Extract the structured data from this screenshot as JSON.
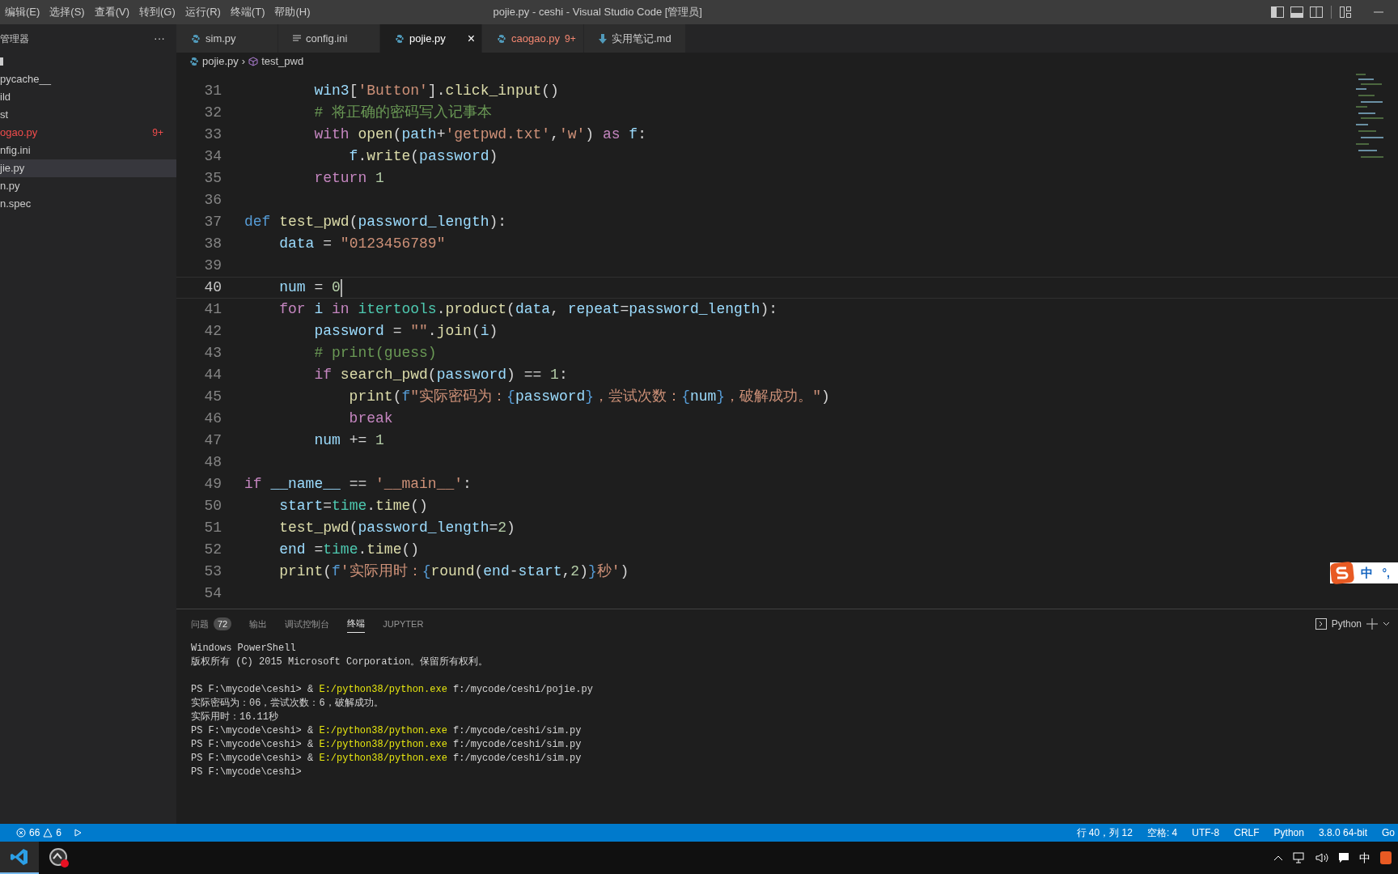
{
  "menu": [
    "编辑(E)",
    "选择(S)",
    "查看(V)",
    "转到(G)",
    "运行(R)",
    "终端(T)",
    "帮助(H)"
  ],
  "window": {
    "title": "pojie.py - ceshi - Visual Studio Code [管理员]"
  },
  "sidebar": {
    "title": "管理器",
    "more": "···",
    "items": [
      {
        "kind": "folder",
        "selected": false
      },
      {
        "label": "pycache__",
        "selected": false,
        "modified": false
      },
      {
        "label": "ild",
        "selected": false,
        "modified": false
      },
      {
        "label": "st",
        "selected": false,
        "modified": false
      },
      {
        "label": "ogao.py",
        "badge": "9+",
        "selected": false,
        "modified": true
      },
      {
        "label": "nfig.ini",
        "selected": false,
        "modified": false
      },
      {
        "label": "jie.py",
        "selected": true,
        "modified": false
      },
      {
        "label": "n.py",
        "selected": false,
        "modified": false
      },
      {
        "label": "n.spec",
        "selected": false,
        "modified": false
      }
    ]
  },
  "tabs": [
    {
      "label": "sim.py",
      "kind": "python",
      "selected": false,
      "modified": false
    },
    {
      "label": "config.ini",
      "kind": "ini",
      "selected": false,
      "modified": false
    },
    {
      "label": "pojie.py",
      "kind": "python",
      "selected": true,
      "modified": false,
      "close": "×"
    },
    {
      "label": "caogao.py",
      "kind": "python",
      "selected": false,
      "modified": true,
      "badge": "9+"
    },
    {
      "label": "实用笔记.md",
      "kind": "markdown",
      "selected": false,
      "modified": false
    }
  ],
  "breadcrumb": {
    "items": [
      "pojie.py",
      "test_pwd"
    ],
    "separator": "›"
  },
  "code": {
    "lines": [
      {
        "number": "31",
        "current": false,
        "segments": [
          {
            "text": "        win3",
            "kind": "variable"
          },
          {
            "text": "[",
            "kind": "plain"
          },
          {
            "text": "'Button'",
            "kind": "string"
          },
          {
            "text": "].",
            "kind": "plain"
          },
          {
            "text": "click_input",
            "kind": "function"
          },
          {
            "text": "()",
            "kind": "plain"
          }
        ]
      },
      {
        "number": "32",
        "current": false,
        "segments": [
          {
            "text": "        # 将正确的密码写入记事本",
            "kind": "comment"
          }
        ]
      },
      {
        "number": "33",
        "current": false,
        "segments": [
          {
            "text": "        with ",
            "kind": "keyword"
          },
          {
            "text": "open",
            "kind": "function"
          },
          {
            "text": "(",
            "kind": "plain"
          },
          {
            "text": "path",
            "kind": "variable"
          },
          {
            "text": "+",
            "kind": "plain"
          },
          {
            "text": "'getpwd.txt'",
            "kind": "string"
          },
          {
            "text": ",",
            "kind": "plain"
          },
          {
            "text": "'w'",
            "kind": "string"
          },
          {
            "text": ") ",
            "kind": "plain"
          },
          {
            "text": "as ",
            "kind": "keyword"
          },
          {
            "text": "f",
            "kind": "variable"
          },
          {
            "text": ":",
            "kind": "plain"
          }
        ]
      },
      {
        "number": "34",
        "current": false,
        "segments": [
          {
            "text": "            f",
            "kind": "variable"
          },
          {
            "text": ".",
            "kind": "plain"
          },
          {
            "text": "write",
            "kind": "function"
          },
          {
            "text": "(",
            "kind": "plain"
          },
          {
            "text": "password",
            "kind": "variable"
          },
          {
            "text": ")",
            "kind": "plain"
          }
        ]
      },
      {
        "number": "35",
        "current": false,
        "segments": [
          {
            "text": "        return ",
            "kind": "keyword"
          },
          {
            "text": "1",
            "kind": "number"
          }
        ]
      },
      {
        "number": "36",
        "current": false
      },
      {
        "number": "37",
        "current": false,
        "segments": [
          {
            "text": "def ",
            "kind": "storage"
          },
          {
            "text": "test_pwd",
            "kind": "function"
          },
          {
            "text": "(",
            "kind": "plain"
          },
          {
            "text": "password_length",
            "kind": "variable"
          },
          {
            "text": "):",
            "kind": "plain"
          }
        ]
      },
      {
        "number": "38",
        "current": false,
        "segments": [
          {
            "text": "    data",
            "kind": "variable"
          },
          {
            "text": " = ",
            "kind": "plain"
          },
          {
            "text": "\"0123456789\"",
            "kind": "string"
          }
        ]
      },
      {
        "number": "39",
        "current": false
      },
      {
        "number": "40",
        "current": true,
        "segments": [
          {
            "text": "    num",
            "kind": "variable"
          },
          {
            "text": " = ",
            "kind": "plain"
          },
          {
            "text": "0",
            "kind": "number"
          }
        ]
      },
      {
        "number": "41",
        "current": false,
        "segments": [
          {
            "text": "    for ",
            "kind": "keyword"
          },
          {
            "text": "i ",
            "kind": "variable"
          },
          {
            "text": "in ",
            "kind": "keyword"
          },
          {
            "text": "itertools",
            "kind": "type"
          },
          {
            "text": ".",
            "kind": "plain"
          },
          {
            "text": "product",
            "kind": "function"
          },
          {
            "text": "(",
            "kind": "plain"
          },
          {
            "text": "data",
            "kind": "variable"
          },
          {
            "text": ", ",
            "kind": "plain"
          },
          {
            "text": "repeat",
            "kind": "variable"
          },
          {
            "text": "=",
            "kind": "plain"
          },
          {
            "text": "password_length",
            "kind": "variable"
          },
          {
            "text": "):",
            "kind": "plain"
          }
        ]
      },
      {
        "number": "42",
        "current": false,
        "segments": [
          {
            "text": "        password",
            "kind": "variable"
          },
          {
            "text": " = ",
            "kind": "plain"
          },
          {
            "text": "\"\"",
            "kind": "string"
          },
          {
            "text": ".",
            "kind": "plain"
          },
          {
            "text": "join",
            "kind": "function"
          },
          {
            "text": "(",
            "kind": "plain"
          },
          {
            "text": "i",
            "kind": "variable"
          },
          {
            "text": ")",
            "kind": "plain"
          }
        ]
      },
      {
        "number": "43",
        "current": false,
        "segments": [
          {
            "text": "        # print(guess)",
            "kind": "comment"
          }
        ]
      },
      {
        "number": "44",
        "current": false,
        "segments": [
          {
            "text": "        if ",
            "kind": "keyword"
          },
          {
            "text": "search_pwd",
            "kind": "function"
          },
          {
            "text": "(",
            "kind": "plain"
          },
          {
            "text": "password",
            "kind": "variable"
          },
          {
            "text": ") == ",
            "kind": "plain"
          },
          {
            "text": "1",
            "kind": "number"
          },
          {
            "text": ":",
            "kind": "plain"
          }
        ]
      },
      {
        "number": "45",
        "current": false,
        "segments": [
          {
            "text": "            print",
            "kind": "function"
          },
          {
            "text": "(",
            "kind": "plain"
          },
          {
            "text": "f",
            "kind": "storage"
          },
          {
            "text": "\"实际密码为：",
            "kind": "string"
          },
          {
            "text": "{",
            "kind": "storage"
          },
          {
            "text": "password",
            "kind": "variable"
          },
          {
            "text": "}",
            "kind": "storage"
          },
          {
            "text": "，尝试次数：",
            "kind": "string"
          },
          {
            "text": "{",
            "kind": "storage"
          },
          {
            "text": "num",
            "kind": "variable"
          },
          {
            "text": "}",
            "kind": "storage"
          },
          {
            "text": "，破解成功。\"",
            "kind": "string"
          },
          {
            "text": ")",
            "kind": "plain"
          }
        ]
      },
      {
        "number": "46",
        "current": false,
        "segments": [
          {
            "text": "            break",
            "kind": "keyword"
          }
        ]
      },
      {
        "number": "47",
        "current": false,
        "segments": [
          {
            "text": "        num",
            "kind": "variable"
          },
          {
            "text": " += ",
            "kind": "plain"
          },
          {
            "text": "1",
            "kind": "number"
          }
        ]
      },
      {
        "number": "48",
        "current": false
      },
      {
        "number": "49",
        "current": false,
        "segments": [
          {
            "text": "if ",
            "kind": "keyword"
          },
          {
            "text": "__name__",
            "kind": "variable"
          },
          {
            "text": " == ",
            "kind": "plain"
          },
          {
            "text": "'__main__'",
            "kind": "string"
          },
          {
            "text": ":",
            "kind": "plain"
          }
        ]
      },
      {
        "number": "50",
        "current": false,
        "segments": [
          {
            "text": "    start",
            "kind": "variable"
          },
          {
            "text": "=",
            "kind": "plain"
          },
          {
            "text": "time",
            "kind": "type"
          },
          {
            "text": ".",
            "kind": "plain"
          },
          {
            "text": "time",
            "kind": "function"
          },
          {
            "text": "()",
            "kind": "plain"
          }
        ]
      },
      {
        "number": "51",
        "current": false,
        "segments": [
          {
            "text": "    test_pwd",
            "kind": "function"
          },
          {
            "text": "(",
            "kind": "plain"
          },
          {
            "text": "password_length",
            "kind": "variable"
          },
          {
            "text": "=",
            "kind": "plain"
          },
          {
            "text": "2",
            "kind": "number"
          },
          {
            "text": ")",
            "kind": "plain"
          }
        ]
      },
      {
        "number": "52",
        "current": false,
        "segments": [
          {
            "text": "    end",
            "kind": "variable"
          },
          {
            "text": " =",
            "kind": "plain"
          },
          {
            "text": "time",
            "kind": "type"
          },
          {
            "text": ".",
            "kind": "plain"
          },
          {
            "text": "time",
            "kind": "function"
          },
          {
            "text": "()",
            "kind": "plain"
          }
        ]
      },
      {
        "number": "53",
        "current": false,
        "segments": [
          {
            "text": "    print",
            "kind": "function"
          },
          {
            "text": "(",
            "kind": "plain"
          },
          {
            "text": "f",
            "kind": "storage"
          },
          {
            "text": "'实际用时：",
            "kind": "string"
          },
          {
            "text": "{",
            "kind": "storage"
          },
          {
            "text": "round",
            "kind": "function"
          },
          {
            "text": "(",
            "kind": "plain"
          },
          {
            "text": "end",
            "kind": "variable"
          },
          {
            "text": "-",
            "kind": "plain"
          },
          {
            "text": "start",
            "kind": "variable"
          },
          {
            "text": ",",
            "kind": "plain"
          },
          {
            "text": "2",
            "kind": "number"
          },
          {
            "text": ")",
            "kind": "plain"
          },
          {
            "text": "}",
            "kind": "storage"
          },
          {
            "text": "秒'",
            "kind": "string"
          },
          {
            "text": ")",
            "kind": "plain"
          }
        ]
      },
      {
        "number": "54",
        "current": false
      }
    ]
  },
  "ime": {
    "mode": "中",
    "punct": "°,"
  },
  "panel": {
    "tabs": [
      {
        "label": "问题",
        "badge": "72",
        "selected": false
      },
      {
        "label": "输出",
        "selected": false
      },
      {
        "label": "调试控制台",
        "selected": false
      },
      {
        "label": "终端",
        "selected": true
      },
      {
        "label": "JUPYTER",
        "selected": false
      }
    ],
    "shell": "Python",
    "terminal": [
      {
        "lines": [
          {
            "segments": [
              {
                "text": "Windows PowerShell",
                "kind": "plain"
              }
            ]
          },
          {
            "segments": [
              {
                "text": "版权所有 (C) 2015 Microsoft Corporation。保留所有权利。",
                "kind": "plain"
              }
            ]
          }
        ]
      },
      {
        "lines": [
          {
            "segments": [
              {
                "text": "PS F:\\mycode\\ceshi> & ",
                "kind": "plain"
              },
              {
                "text": "E:/python38/python.exe",
                "kind": "highlight"
              },
              {
                "text": " f:/mycode/ceshi/pojie.py",
                "kind": "plain"
              }
            ]
          },
          {
            "segments": [
              {
                "text": "实际密码为：06，尝试次数：6，破解成功。",
                "kind": "plain"
              }
            ]
          },
          {
            "segments": [
              {
                "text": "实际用时：16.11秒",
                "kind": "plain"
              }
            ]
          },
          {
            "segments": [
              {
                "text": "PS F:\\mycode\\ceshi> & ",
                "kind": "plain"
              },
              {
                "text": "E:/python38/python.exe",
                "kind": "highlight"
              },
              {
                "text": " f:/mycode/ceshi/sim.py",
                "kind": "plain"
              }
            ]
          },
          {
            "segments": [
              {
                "text": "PS F:\\mycode\\ceshi> & ",
                "kind": "plain"
              },
              {
                "text": "E:/python38/python.exe",
                "kind": "highlight"
              },
              {
                "text": " f:/mycode/ceshi/sim.py",
                "kind": "plain"
              }
            ]
          },
          {
            "segments": [
              {
                "text": "PS F:\\mycode\\ceshi> & ",
                "kind": "plain"
              },
              {
                "text": "E:/python38/python.exe",
                "kind": "highlight"
              },
              {
                "text": " f:/mycode/ceshi/sim.py",
                "kind": "plain"
              }
            ]
          },
          {
            "segments": [
              {
                "text": "PS F:\\mycode\\ceshi>",
                "kind": "plain"
              }
            ]
          }
        ]
      }
    ]
  },
  "status_bar": {
    "errors": "66",
    "warnings": "6",
    "right": [
      "行 40，列 12",
      "空格: 4",
      "UTF-8",
      "CRLF",
      "Python",
      "3.8.0 64-bit",
      "Go"
    ]
  },
  "taskbar": {
    "ime": "中"
  }
}
